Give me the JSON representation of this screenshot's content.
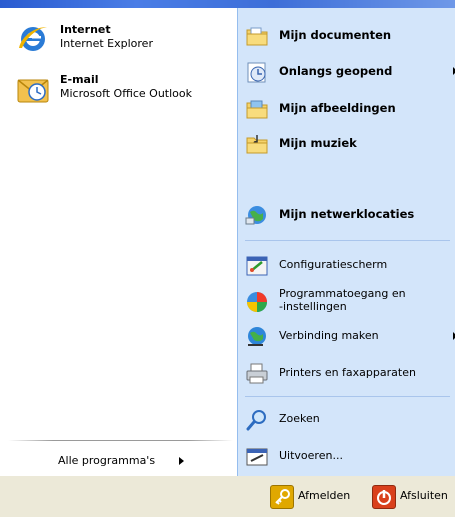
{
  "pinned": [
    {
      "title": "Internet",
      "subtitle": "Internet Explorer",
      "icon": "internet-explorer-icon"
    },
    {
      "title": "E-mail",
      "subtitle": "Microsoft Office Outlook",
      "icon": "outlook-icon"
    }
  ],
  "all_programs": {
    "label": "Alle programma's"
  },
  "places": [
    {
      "label": "Mijn documenten",
      "icon": "documents-folder-icon",
      "bold": true
    },
    {
      "label": "Onlangs geopend",
      "icon": "recent-documents-icon",
      "bold": true,
      "submenu": true
    },
    {
      "label": "Mijn afbeeldingen",
      "icon": "pictures-folder-icon",
      "bold": true
    },
    {
      "label": "Mijn muziek",
      "icon": "music-folder-icon",
      "bold": true
    },
    {
      "label": "Mijn netwerklocaties",
      "icon": "network-places-icon",
      "bold": true
    }
  ],
  "system": [
    {
      "label": "Configuratiescherm",
      "icon": "control-panel-icon"
    },
    {
      "label": "Programmatoegang en",
      "label2": "-instellingen",
      "icon": "program-access-icon"
    },
    {
      "label": "Verbinding maken",
      "icon": "connect-to-icon",
      "submenu": true
    },
    {
      "label": "Printers en faxapparaten",
      "icon": "printers-icon"
    }
  ],
  "tools": [
    {
      "label": "Zoeken",
      "icon": "search-icon"
    },
    {
      "label": "Uitvoeren...",
      "icon": "run-icon"
    }
  ],
  "footer": {
    "logoff_label": "Afmelden",
    "shutdown_label": "Afsluiten"
  },
  "colors": {
    "right_panel": "#d3e5fa",
    "title_bar": "#2a5bd0",
    "logoff_icon": "#e0a800",
    "shutdown_icon": "#d9401c"
  }
}
